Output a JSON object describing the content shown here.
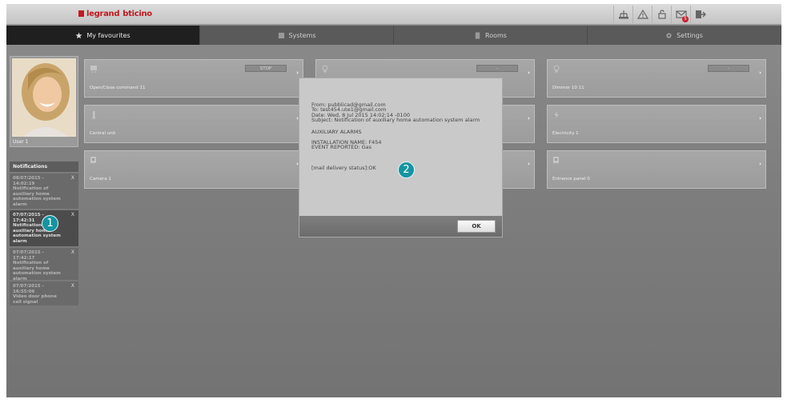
{
  "header": {
    "logo_part1": "legrand",
    "logo_part2": "bticino",
    "icons": [
      "network-icon",
      "warning-icon",
      "lock-icon",
      "mail-icon",
      "logout-icon"
    ],
    "mail_badge": "5"
  },
  "nav": {
    "tabs": [
      {
        "label": "My favourites",
        "icon": "star-icon"
      },
      {
        "label": "Systems",
        "icon": "systems-icon"
      },
      {
        "label": "Rooms",
        "icon": "door-icon"
      },
      {
        "label": "Settings",
        "icon": "gear-icon"
      }
    ]
  },
  "profile": {
    "user": "User 1"
  },
  "notifications": {
    "title": "Notifications",
    "close": "X",
    "items": [
      {
        "date": "08/07/2015 -",
        "time": "14:02:19",
        "text": "Notification of auxiliary home automation system alarm"
      },
      {
        "date": "07/07/2015 -",
        "time": "17:42:31",
        "text": "Notification of auxiliary home automation system alarm"
      },
      {
        "date": "07/07/2015 -",
        "time": "17:42:17",
        "text": "Notification of auxiliary home automation system alarm"
      },
      {
        "date": "07/07/2015 -",
        "time": "16:55:06",
        "text": "Video door phone call signal"
      }
    ]
  },
  "tiles": {
    "t1": {
      "label": "Open/Close command 11",
      "button": "STOP"
    },
    "t2": {
      "label": "Central unit"
    },
    "t3": {
      "label": "Camera 1"
    },
    "t4": {
      "label": "Dimmer 10 11",
      "button": "-"
    },
    "t5": {
      "label": "Electricity 1"
    },
    "t6": {
      "label": "Entrance panel 0"
    },
    "t7": {
      "button": "-"
    },
    "arrow": "›"
  },
  "dialog": {
    "from": "From: pubblicad@gmail.com",
    "to": "To: test454.ute1@gmail.com",
    "date": "Date: Wed, 8 Jul 2015 14:02:14 -0100",
    "subject": "Subject: Notification of auxiliary home automation system alarm",
    "heading": "AUXILIARY ALARMS",
    "installation": "INSTALLATION NAME: F454",
    "event": "EVENT REPORTED: Gas",
    "status": "[mail delivery status]:OK",
    "ok": "OK"
  },
  "callouts": {
    "c1": "1",
    "c2": "2"
  }
}
